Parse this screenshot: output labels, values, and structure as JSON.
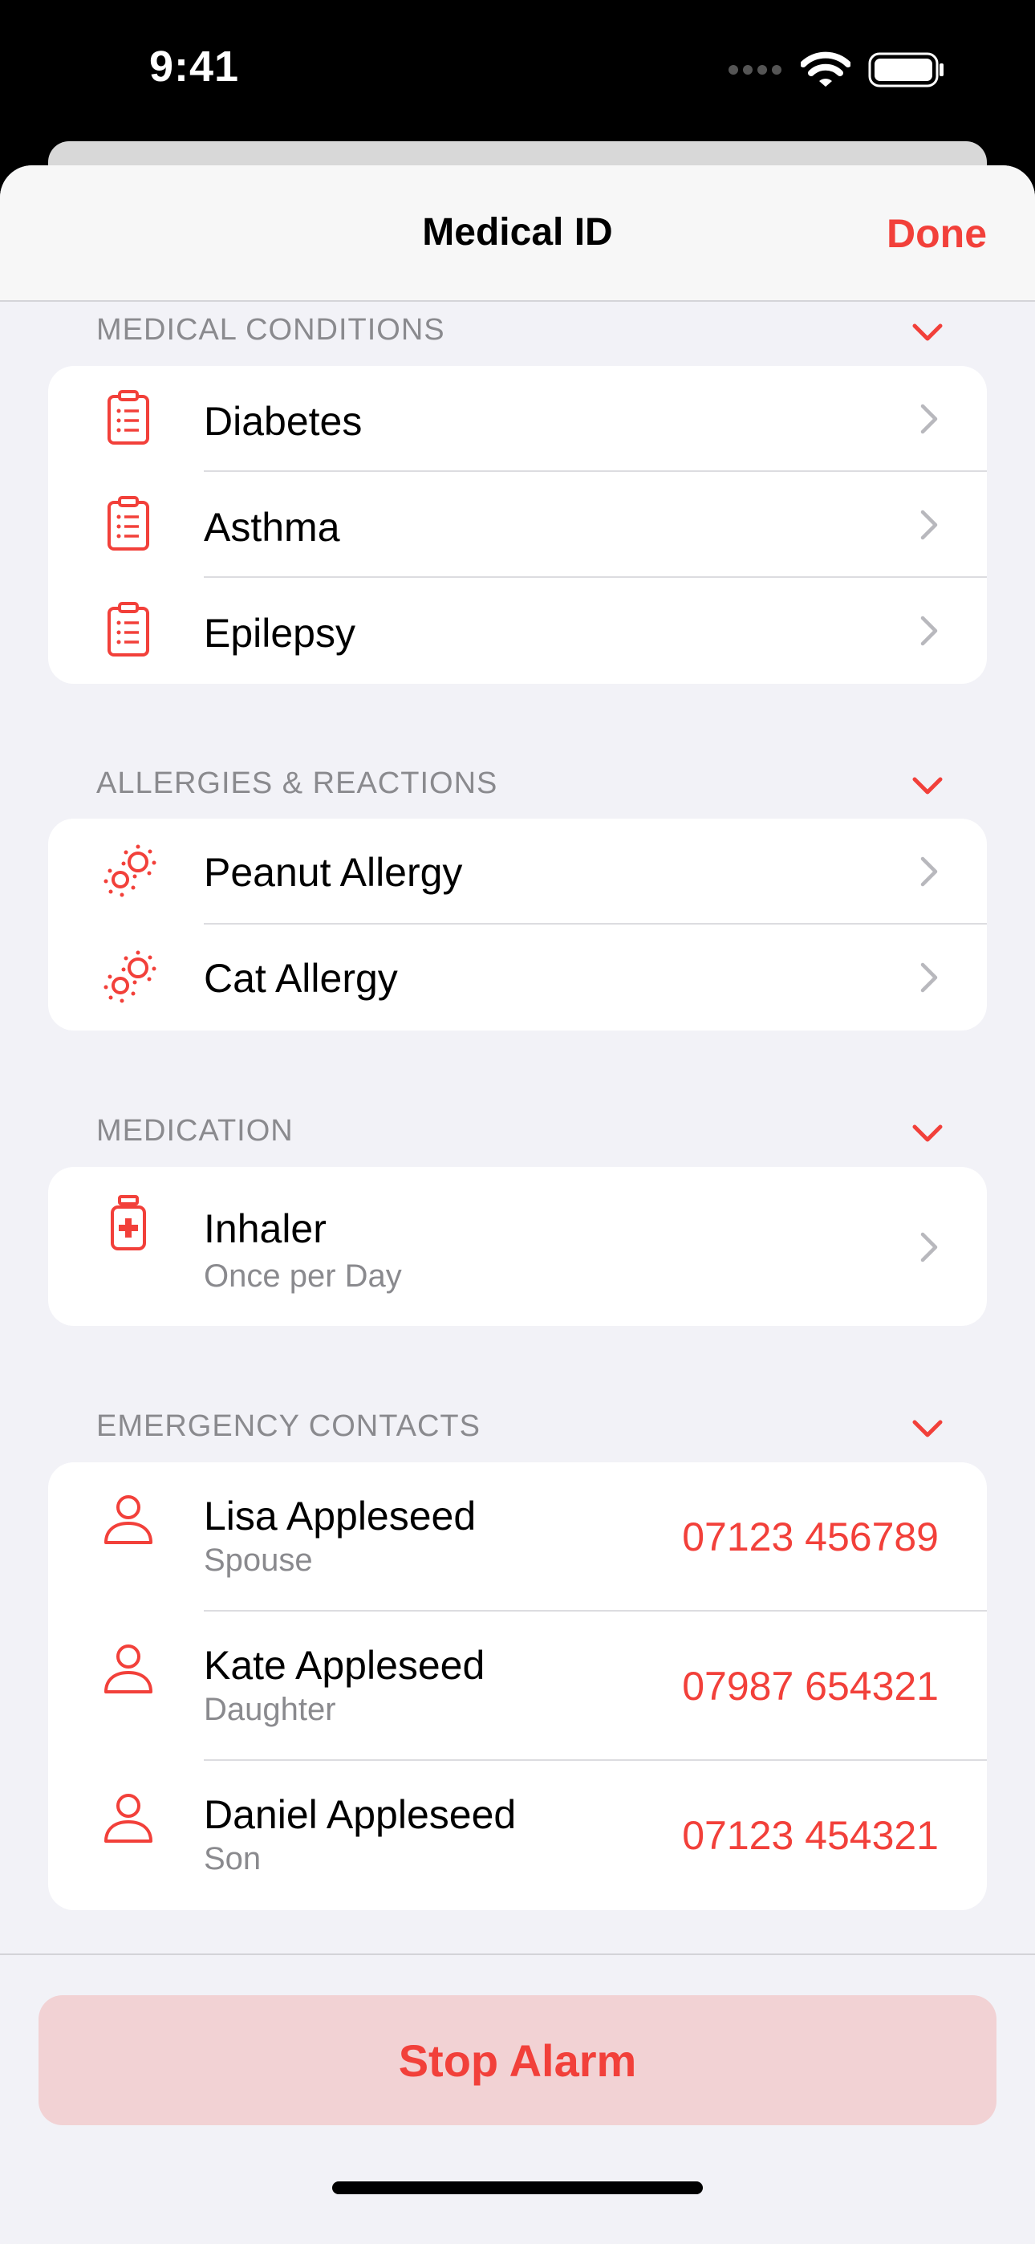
{
  "status_bar": {
    "time": "9:41"
  },
  "nav": {
    "title": "Medical ID",
    "done_label": "Done"
  },
  "sections": {
    "conditions": {
      "header": "MEDICAL CONDITIONS",
      "items": [
        "Diabetes",
        "Asthma",
        "Epilepsy"
      ]
    },
    "allergies": {
      "header": "ALLERGIES & REACTIONS",
      "items": [
        "Peanut Allergy",
        "Cat Allergy"
      ]
    },
    "medication": {
      "header": "MEDICATION",
      "items": [
        {
          "name": "Inhaler",
          "frequency": "Once per Day"
        }
      ]
    },
    "contacts": {
      "header": "EMERGENCY CONTACTS",
      "items": [
        {
          "name": "Lisa Appleseed",
          "relation": "Spouse",
          "phone": "07123 456789"
        },
        {
          "name": "Kate Appleseed",
          "relation": "Daughter",
          "phone": "07987 654321"
        },
        {
          "name": "Daniel Appleseed",
          "relation": "Son",
          "phone": "07123 454321"
        }
      ]
    }
  },
  "footer": {
    "stop_label": "Stop Alarm"
  },
  "icons": {
    "condition": "clipboard-icon",
    "allergy": "allergen-icon",
    "medication": "medicine-bottle-icon",
    "contact": "person-icon",
    "disclosure": "chevron-right-icon",
    "collapse": "chevron-down-icon"
  },
  "colors": {
    "accent": "#f2403a",
    "background": "#f2f2f7",
    "stop_button_bg": "#f2d2d4",
    "secondary_text": "#8a8a8e"
  }
}
